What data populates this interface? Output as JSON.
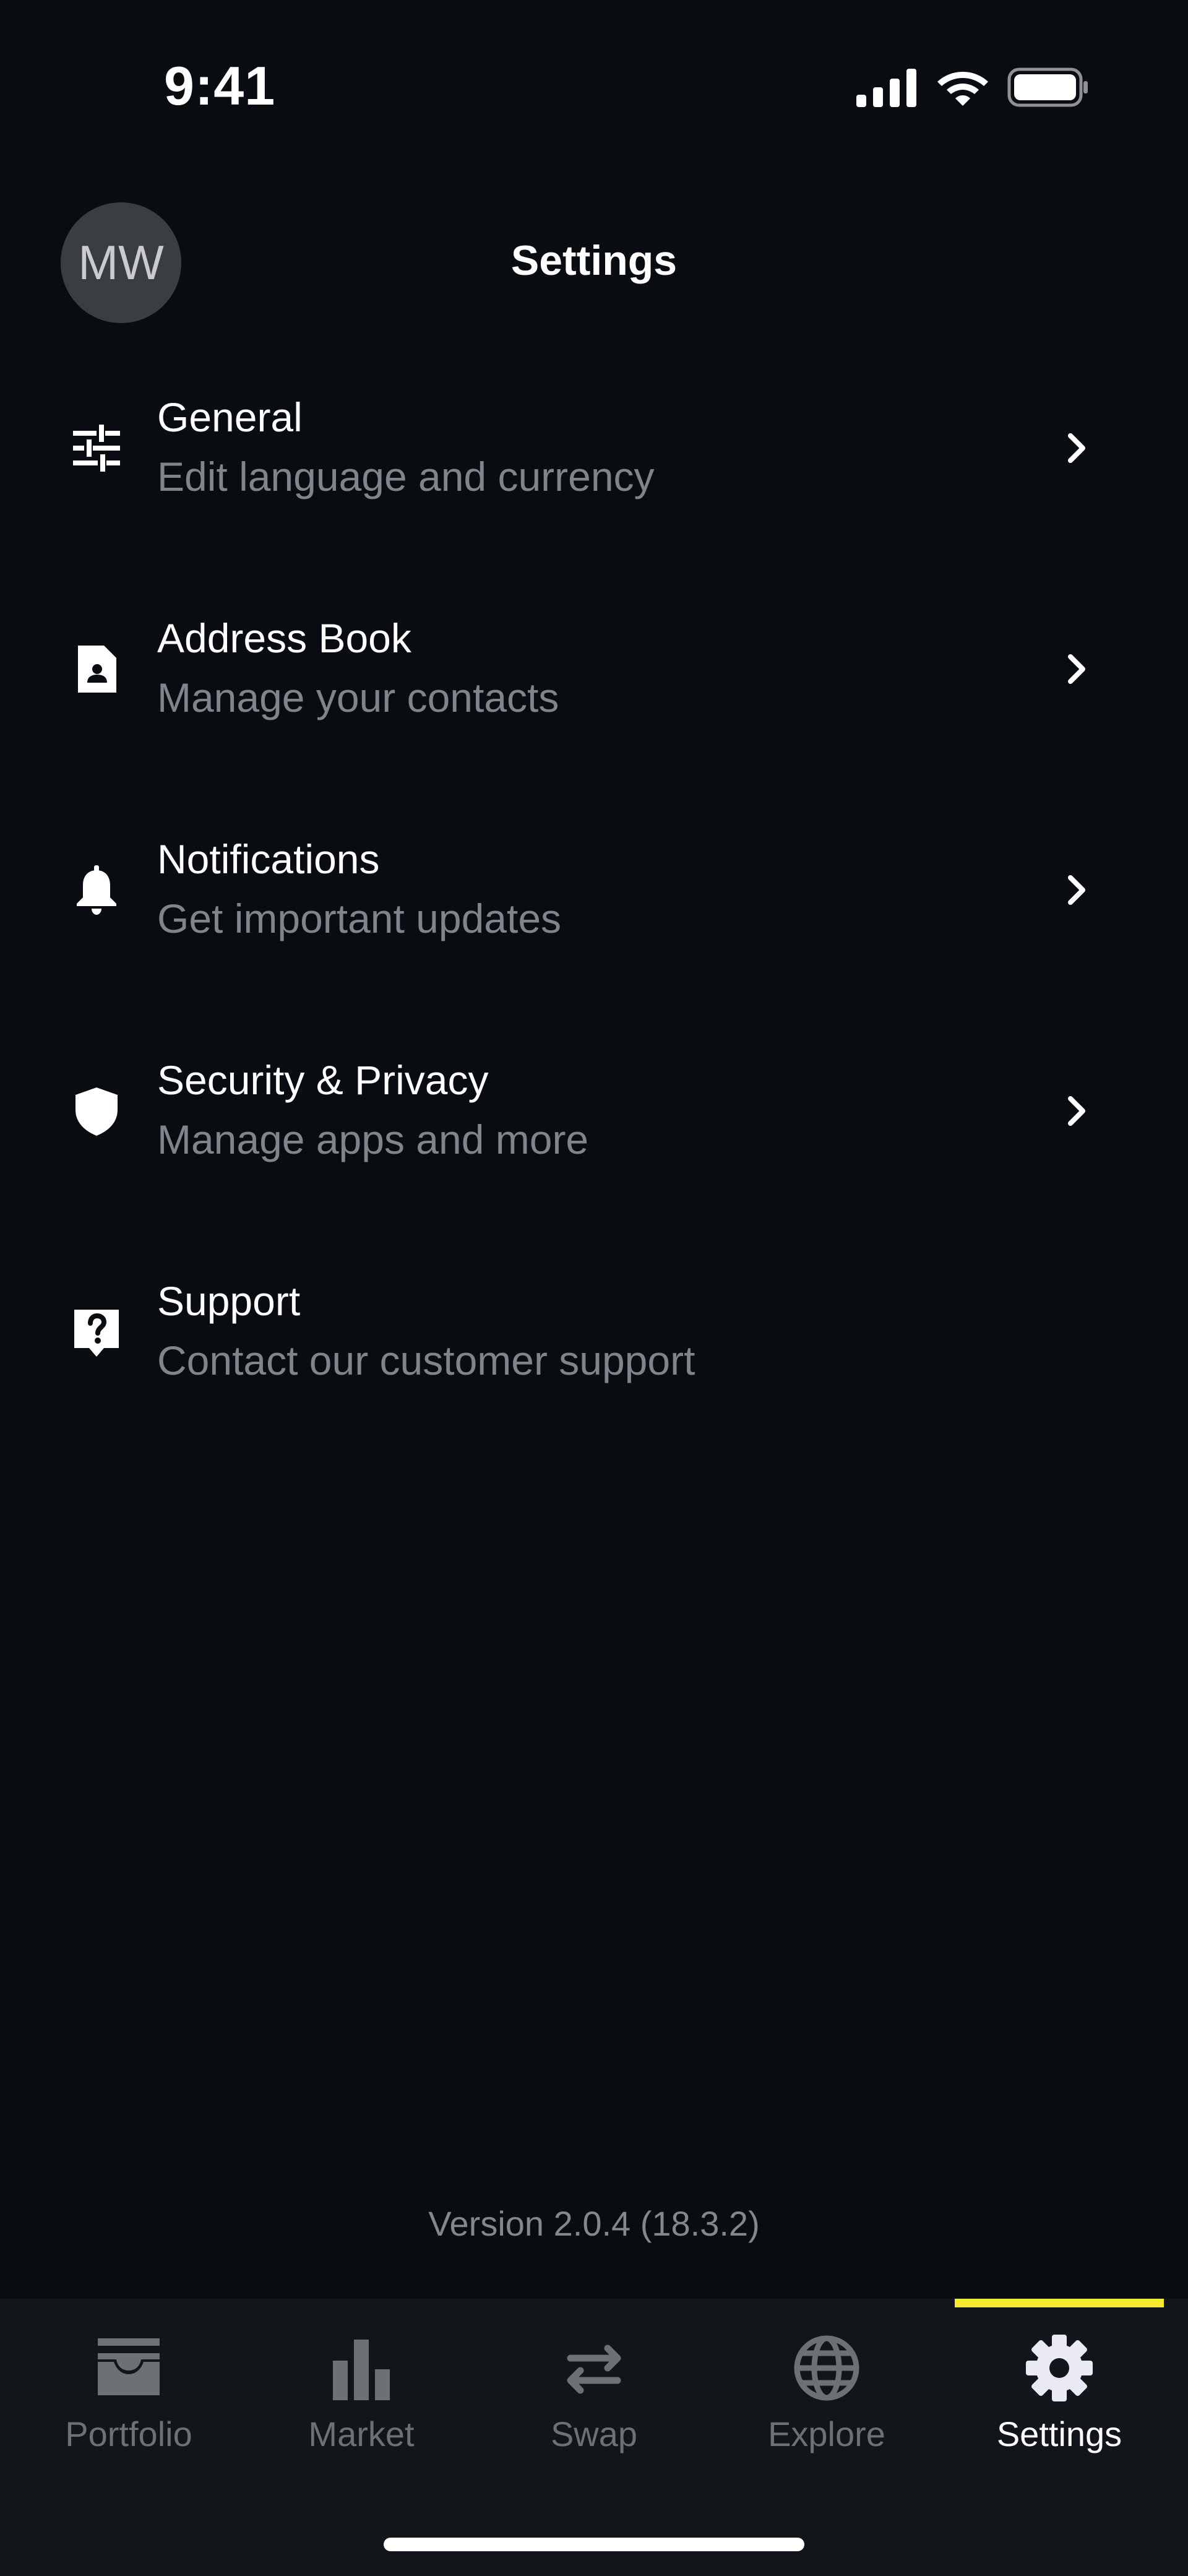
{
  "status_bar": {
    "time": "9:41"
  },
  "header": {
    "avatar_initials": "MW",
    "title": "Settings"
  },
  "settings": {
    "items": [
      {
        "icon": "sliders-icon",
        "title": "General",
        "subtitle": "Edit language and currency",
        "has_chevron": true
      },
      {
        "icon": "contact-book-icon",
        "title": "Address Book",
        "subtitle": "Manage your contacts",
        "has_chevron": true
      },
      {
        "icon": "bell-icon",
        "title": "Notifications",
        "subtitle": "Get important updates",
        "has_chevron": true
      },
      {
        "icon": "shield-icon",
        "title": "Security & Privacy",
        "subtitle": "Manage apps and more",
        "has_chevron": true
      },
      {
        "icon": "help-icon",
        "title": "Support",
        "subtitle": "Contact our customer support",
        "has_chevron": false
      }
    ]
  },
  "version": "Version 2.0.4 (18.3.2)",
  "tab_bar": {
    "active_tab": "Settings",
    "accent_color": "#f7e932",
    "tabs": [
      {
        "label": "Portfolio",
        "icon": "wallet-icon"
      },
      {
        "label": "Market",
        "icon": "bar-chart-icon"
      },
      {
        "label": "Swap",
        "icon": "swap-arrows-icon"
      },
      {
        "label": "Explore",
        "icon": "globe-icon"
      },
      {
        "label": "Settings",
        "icon": "gear-icon"
      }
    ]
  }
}
